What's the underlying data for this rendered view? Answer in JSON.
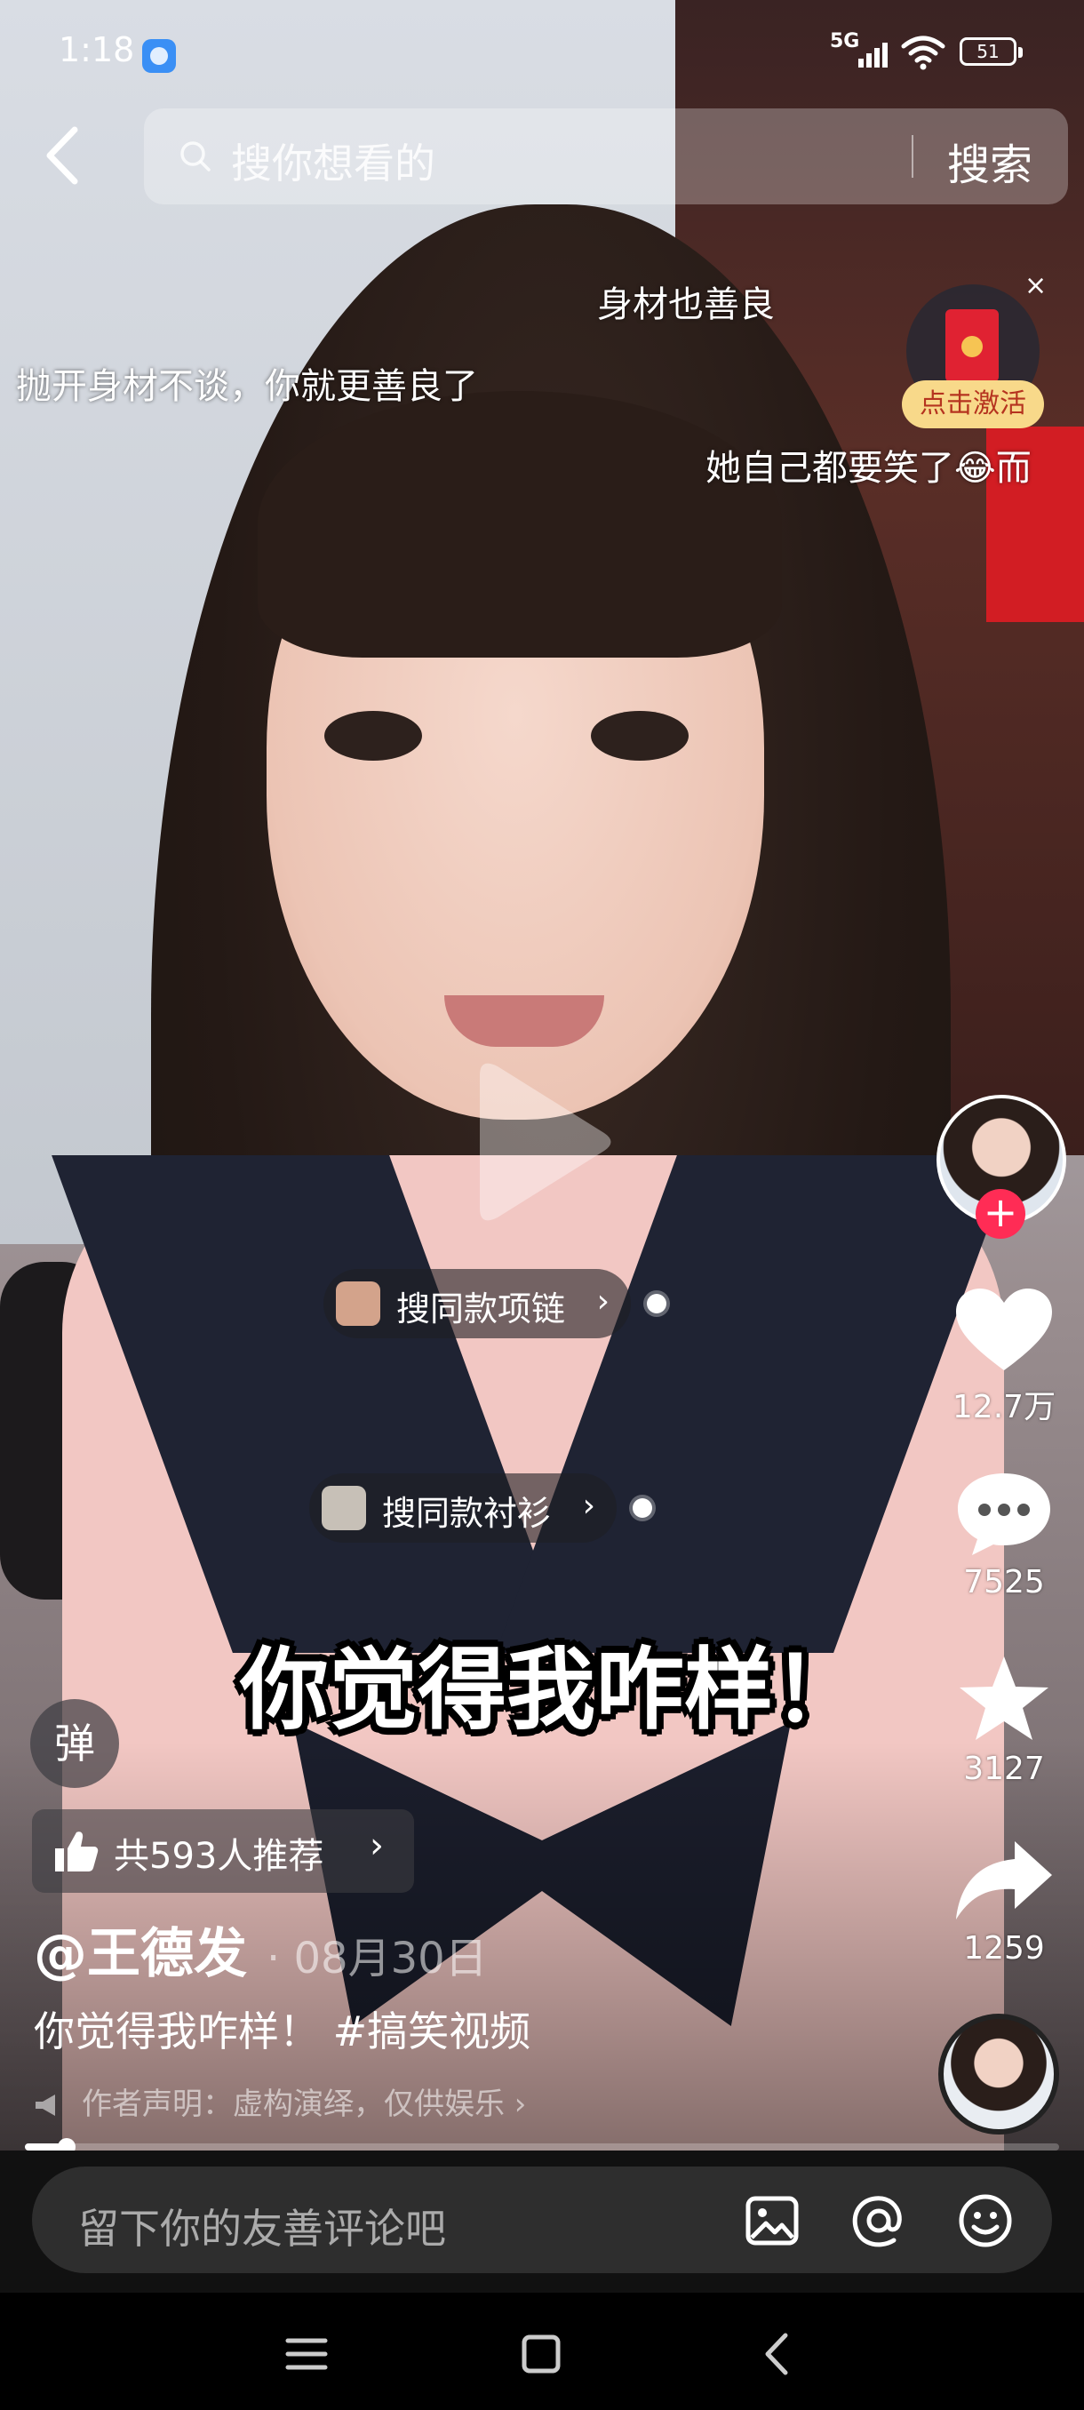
{
  "status_bar": {
    "time": "1:18",
    "network": "5G",
    "battery": "51"
  },
  "search": {
    "placeholder": "搜你想看的",
    "button": "搜索"
  },
  "danmaku": [
    "身材也善良",
    "抛开身材不谈，你就更善良了",
    "她自己都要笑了😂而"
  ],
  "red_packet": {
    "label": "点击激活",
    "close": "×"
  },
  "product_tags": [
    {
      "label": "搜同款项链",
      "chevron": "›"
    },
    {
      "label": "搜同款衬衫",
      "chevron": "›"
    }
  ],
  "caption": "你觉得我咋样！",
  "actions": {
    "likes": "12.7万",
    "comments": "7525",
    "favorites": "3127",
    "shares": "1259",
    "follow": "+"
  },
  "danmu_toggle": "弹",
  "recommend": {
    "label": "共593人推荐",
    "chevron": "›"
  },
  "author": "@王德发",
  "date": "· 08月30日",
  "description": "你觉得我咋样！ #搞笑视频",
  "disclaimer": "作者声明：虚构演绎，仅供娱乐 ›",
  "progress": 0.04,
  "comment_placeholder": "留下你的友善评论吧",
  "icons": {
    "back": "chevron-left-icon",
    "search": "search-icon",
    "play": "play-icon",
    "like": "heart-icon",
    "comment": "comment-icon",
    "favorite": "star-icon",
    "share": "share-icon",
    "image": "image-icon",
    "mention": "at-icon",
    "emoji": "emoji-icon",
    "thumbs_up": "thumbs-up-icon"
  },
  "colors": {
    "follow_badge": "#ff2c55",
    "red_packet_label_bg": "#f8d98a",
    "comment_bar": "#111111"
  }
}
